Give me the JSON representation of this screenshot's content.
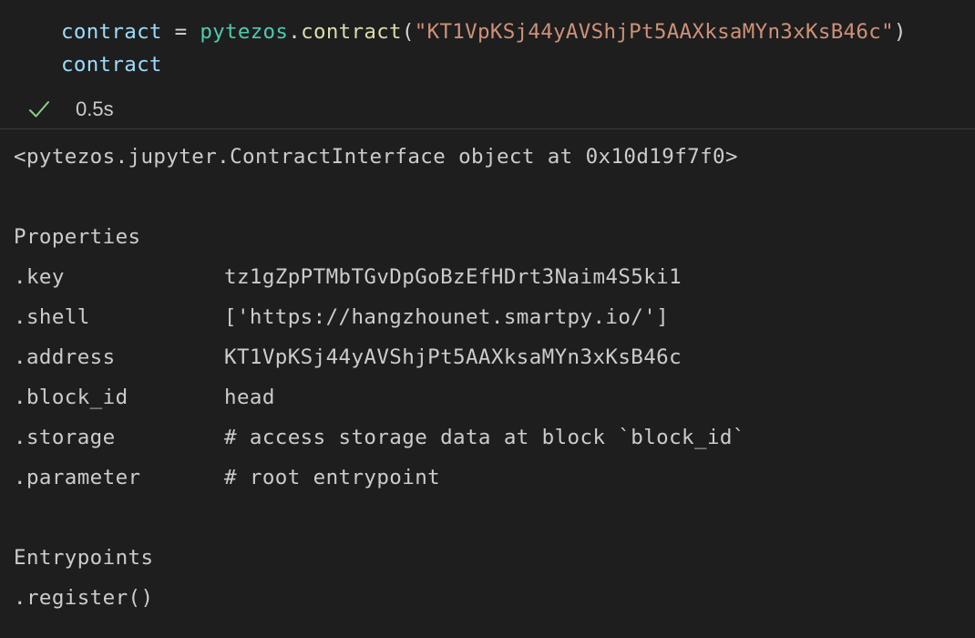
{
  "code": {
    "line1": {
      "var": "contract",
      "op": " = ",
      "module": "pytezos",
      "dot": ".",
      "func": "contract",
      "open_paren": "(",
      "arg": "\"KT1VpKSj44yAVShjPt5AAXksaMYn3xKsB46c\"",
      "close_paren": ")"
    },
    "line2": "contract"
  },
  "status": {
    "icon": "check-icon",
    "duration": "0.5s",
    "check_color": "#89d185"
  },
  "output": {
    "repr": "<pytezos.jupyter.ContractInterface object at 0x10d19f7f0>",
    "properties_heading": "Properties",
    "properties": [
      {
        "name": ".key",
        "value": "tz1gZpPTMbTGvDpGoBzEfHDrt3Naim4S5ki1"
      },
      {
        "name": ".shell",
        "value": "['https://hangzhounet.smartpy.io/']"
      },
      {
        "name": ".address",
        "value": "KT1VpKSj44yAVShjPt5AAXksaMYn3xKsB46c"
      },
      {
        "name": ".block_id",
        "value": "head"
      },
      {
        "name": ".storage",
        "value": "# access storage data at block `block_id`"
      },
      {
        "name": ".parameter",
        "value": "# root entrypoint"
      }
    ],
    "entrypoints_heading": "Entrypoints",
    "entrypoints": [
      ".register()"
    ]
  }
}
